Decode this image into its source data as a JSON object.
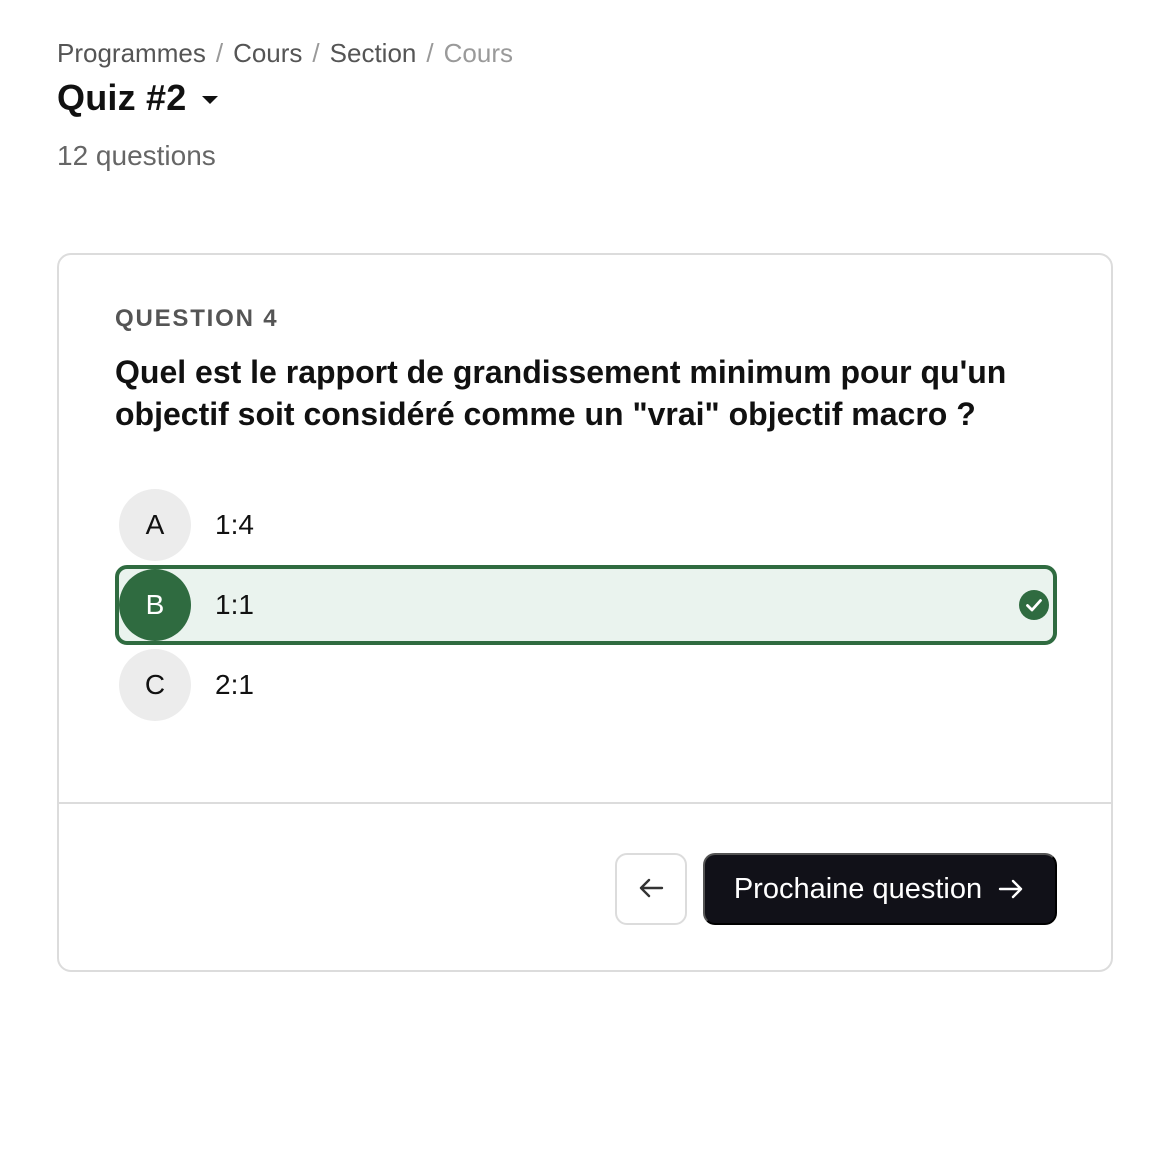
{
  "breadcrumb": {
    "items": [
      "Programmes",
      "Cours",
      "Section"
    ],
    "current": "Cours",
    "separator": "/"
  },
  "header": {
    "title": "Quiz #2",
    "subtitle": "12 questions",
    "dropdown_icon": "caret-down-icon"
  },
  "question": {
    "label": "QUESTION 4",
    "text": "Quel est le rapport de grandissement minimum pour qu'un objectif soit considéré comme un \"vrai\" objectif macro ?"
  },
  "options": [
    {
      "letter": "A",
      "value": "1:4",
      "selected": false
    },
    {
      "letter": "B",
      "value": "1:1",
      "selected": true,
      "icon": "check-circle-icon"
    },
    {
      "letter": "C",
      "value": "2:1",
      "selected": false
    }
  ],
  "footer": {
    "back_icon": "arrow-left-icon",
    "next_label": "Prochaine question",
    "next_icon": "arrow-right-icon"
  },
  "colors": {
    "selected_accent": "#2f6b40",
    "selected_background": "#eaf3ee",
    "primary_button": "#111118"
  }
}
